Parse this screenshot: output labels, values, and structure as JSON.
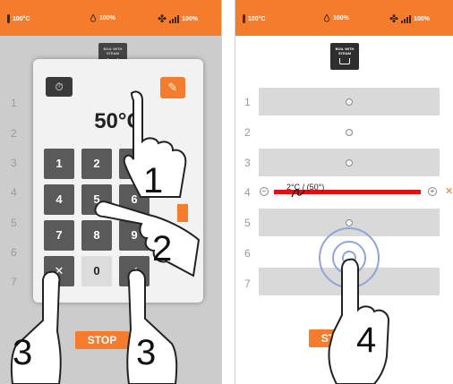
{
  "status": {
    "temperature": "100°C",
    "humidity": "100%",
    "fan": "100%"
  },
  "header": {
    "program_line1": "BOIL WITH",
    "program_line2": "STEAM"
  },
  "rows": [
    "1",
    "2",
    "3",
    "4",
    "5",
    "6",
    "7"
  ],
  "keypad": {
    "temperature": "50°C",
    "timer_icon": "⏱",
    "probe_icon": "✎",
    "keys": [
      "1",
      "2",
      "3",
      "4",
      "5",
      "6",
      "7",
      "8",
      "9",
      "✕",
      "0",
      "✓"
    ]
  },
  "stop_label": "STOP",
  "probe": {
    "label": "2°C / (50°)",
    "minus": "−",
    "plus": "+",
    "close": "✕"
  },
  "steps": [
    "1",
    "2",
    "3",
    "3",
    "4"
  ],
  "colors": {
    "accent": "#f47c2c",
    "probe_line": "#e01010",
    "ring": "#8fa4d8"
  },
  "icons": [
    "thermometer-icon",
    "humidity-drop-icon",
    "fan-icon",
    "signal-icon",
    "timer-icon",
    "probe-icon",
    "pot-icon",
    "hand-pointer-icon"
  ]
}
